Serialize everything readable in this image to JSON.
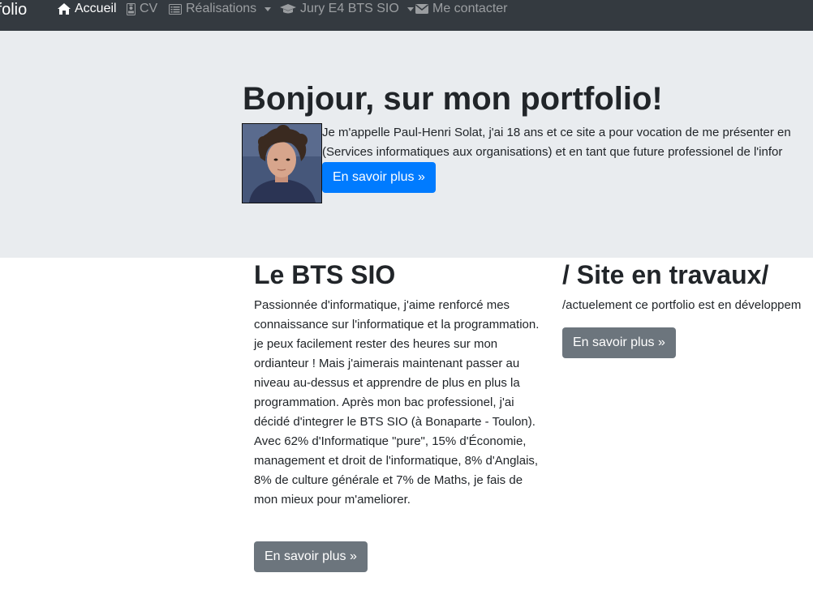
{
  "navbar": {
    "brand": "tfolio",
    "items": [
      {
        "label": "Accueil",
        "icon": "home-icon"
      },
      {
        "label": "CV",
        "icon": "badge-icon"
      },
      {
        "label": "Réalisations",
        "icon": "list-icon"
      },
      {
        "label": "Jury E4 BTS SIO",
        "icon": "graduation-cap-icon"
      },
      {
        "label": "Me contacter",
        "icon": "envelope-icon"
      }
    ]
  },
  "jumbotron": {
    "title": "Bonjour, sur mon portfolio!",
    "line1": "Je m'appelle Paul-Henri Solat, j'ai 18 ans et ce site a pour vocation de me présenter en",
    "line2": "(Services informatiques aux organisations) et en tant que future professionel de l'infor",
    "button": "En savoir plus »"
  },
  "columns": {
    "bts": {
      "title": "Le BTS SIO",
      "text": "Passionnée d'informatique, j'aime renforcé mes connaissance sur l'informatique et la programmation. je peux facilement rester des heures sur mon ordianteur ! Mais j'aimerais maintenant passer au niveau au-dessus et apprendre de plus en plus la programmation. Après mon bac professionel, j'ai décidé d'integrer le BTS SIO (à Bonaparte - Toulon). Avec 62% d'Informatique \"pure\", 15% d'Économie, management et droit de l'informatique, 8% d'Anglais, 8% de culture générale et 7% de Maths, je fais de mon mieux pour m'ameliorer.",
      "button": "En savoir plus »"
    },
    "travaux": {
      "title": "/ Site en travaux/",
      "text": "/actuelement ce portfolio est en développem",
      "button": "En savoir plus »"
    }
  },
  "colors": {
    "navbar_bg": "#343a40",
    "jumbotron_bg": "#e9ecef",
    "primary": "#007bff",
    "secondary": "#6c757d"
  }
}
